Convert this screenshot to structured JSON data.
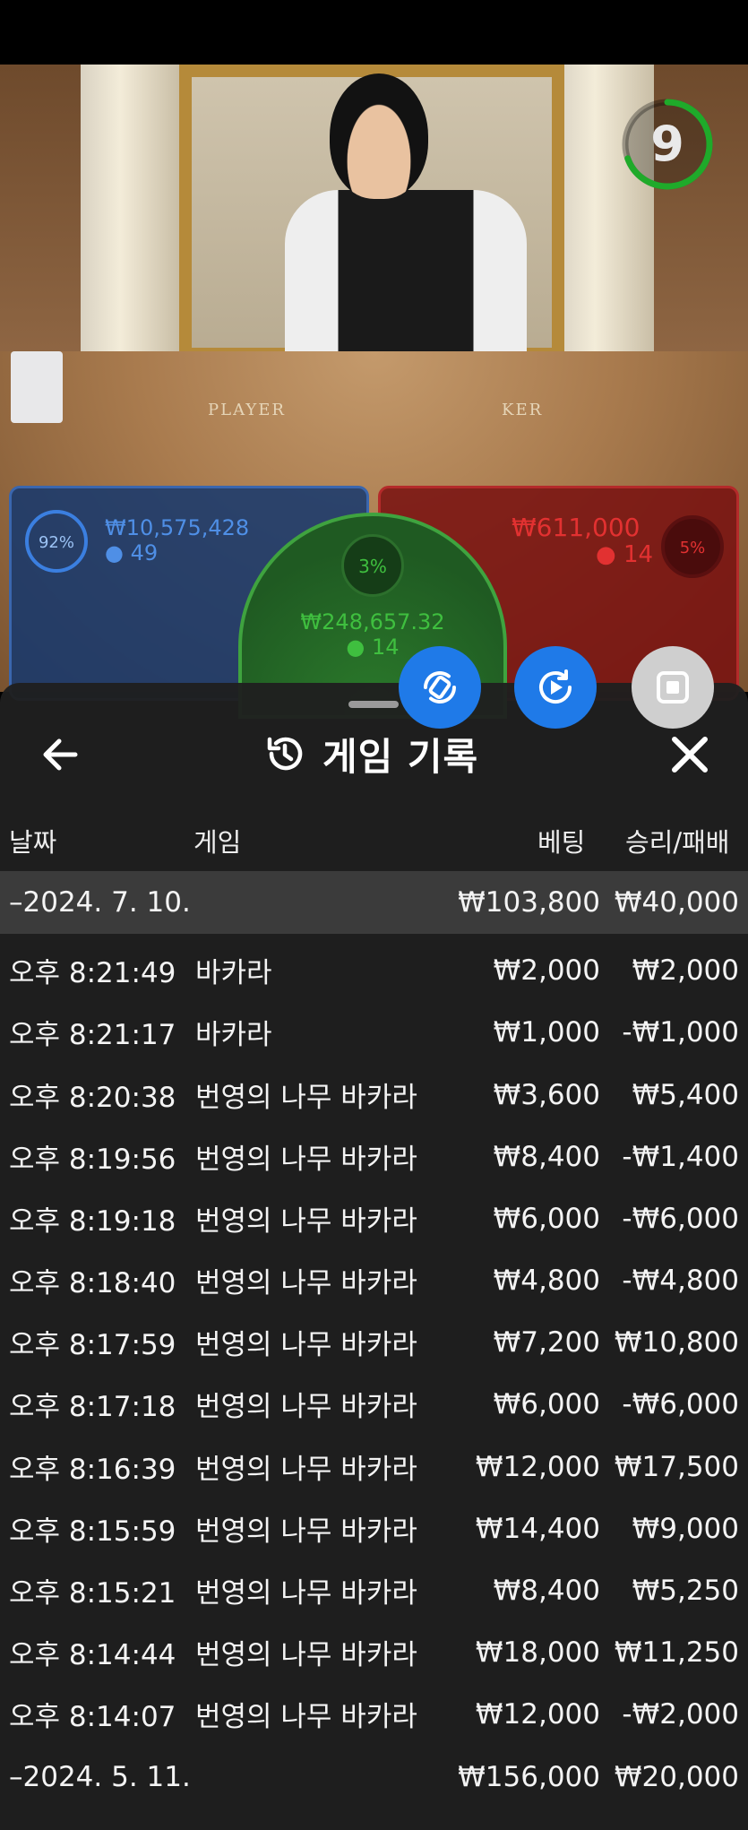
{
  "scene": {
    "timer": "9",
    "felt_player": "PLAYER",
    "felt_banker": "KER",
    "player": {
      "percent": "92%",
      "amount": "₩10,575,428",
      "players": "49"
    },
    "tie": {
      "percent": "3%",
      "amount": "₩248,657.32",
      "players": "14"
    },
    "banker": {
      "percent": "5%",
      "amount": "₩611,000",
      "players": "14"
    }
  },
  "colors": {
    "player": "#3b7fe0",
    "banker": "#e02424",
    "tie": "#3fbf3f",
    "action_blue": "#1f7ae8"
  },
  "panel": {
    "title": "게임 기록",
    "icons": {
      "back": "arrow-left-icon",
      "history": "history-icon",
      "close": "close-icon"
    },
    "headers": {
      "date": "날짜",
      "game": "게임",
      "bet": "베팅",
      "result": "승리/패배"
    },
    "groups": [
      {
        "date": "–2024. 7. 10.",
        "bet_total": "₩103,800",
        "result_total": "₩40,000",
        "rows": [
          {
            "time": "오후 8:21:49",
            "game": "바카라",
            "bet": "₩2,000",
            "result": "₩2,000"
          },
          {
            "time": "오후 8:21:17",
            "game": "바카라",
            "bet": "₩1,000",
            "result": "-₩1,000"
          },
          {
            "time": "오후 8:20:38",
            "game": "번영의 나무 바카라",
            "bet": "₩3,600",
            "result": "₩5,400"
          },
          {
            "time": "오후 8:19:56",
            "game": "번영의 나무 바카라",
            "bet": "₩8,400",
            "result": "-₩1,400"
          },
          {
            "time": "오후 8:19:18",
            "game": "번영의 나무 바카라",
            "bet": "₩6,000",
            "result": "-₩6,000"
          },
          {
            "time": "오후 8:18:40",
            "game": "번영의 나무 바카라",
            "bet": "₩4,800",
            "result": "-₩4,800"
          },
          {
            "time": "오후 8:17:59",
            "game": "번영의 나무 바카라",
            "bet": "₩7,200",
            "result": "₩10,800"
          },
          {
            "time": "오후 8:17:18",
            "game": "번영의 나무 바카라",
            "bet": "₩6,000",
            "result": "-₩6,000"
          },
          {
            "time": "오후 8:16:39",
            "game": "번영의 나무 바카라",
            "bet": "₩12,000",
            "result": "₩17,500"
          },
          {
            "time": "오후 8:15:59",
            "game": "번영의 나무 바카라",
            "bet": "₩14,400",
            "result": "₩9,000"
          },
          {
            "time": "오후 8:15:21",
            "game": "번영의 나무 바카라",
            "bet": "₩8,400",
            "result": "₩5,250"
          },
          {
            "time": "오후 8:14:44",
            "game": "번영의 나무 바카라",
            "bet": "₩18,000",
            "result": "₩11,250"
          },
          {
            "time": "오후 8:14:07",
            "game": "번영의 나무 바카라",
            "bet": "₩12,000",
            "result": "-₩2,000"
          }
        ]
      },
      {
        "date": "–2024. 5. 11.",
        "bet_total": "₩156,000",
        "result_total": "₩20,000",
        "rows": []
      }
    ]
  }
}
